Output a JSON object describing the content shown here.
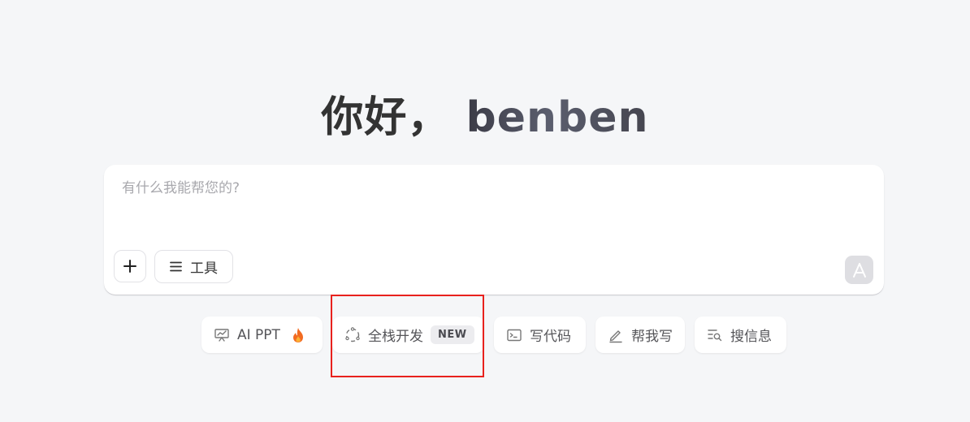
{
  "greeting": {
    "hello": "你好，",
    "username": "benben"
  },
  "chat": {
    "placeholder": "有什么我能帮您的?",
    "add_icon": "plus-icon",
    "tools_icon": "menu-icon",
    "tools_label": "工具",
    "send_icon": "send-arrow-icon"
  },
  "quick_actions": [
    {
      "label": "AI PPT",
      "icon": "presentation-icon",
      "suffix_icon": "fire-icon"
    },
    {
      "label": "全栈开发",
      "icon": "dotted-circle-icon",
      "badge": "NEW"
    },
    {
      "label": "写代码",
      "icon": "terminal-icon"
    },
    {
      "label": "帮我写",
      "icon": "pencil-icon"
    },
    {
      "label": "搜信息",
      "icon": "search-list-icon"
    }
  ],
  "colors": {
    "background": "#f5f6f8",
    "highlight": "#e8211d"
  }
}
